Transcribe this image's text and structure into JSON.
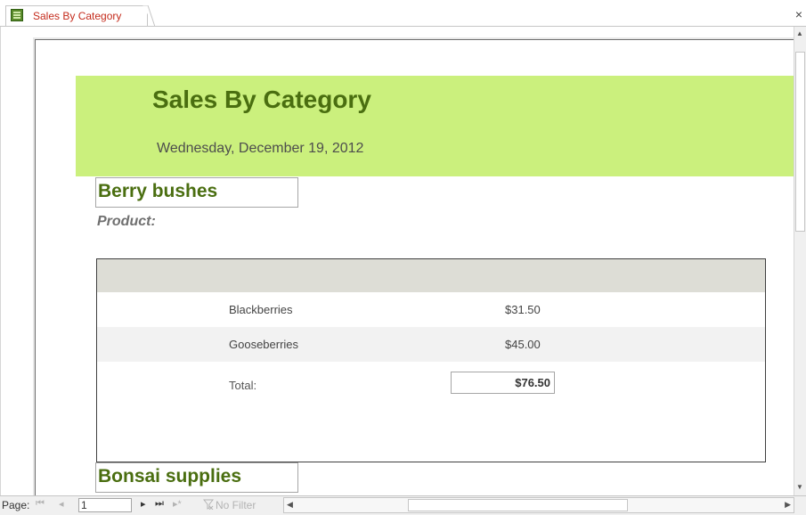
{
  "window": {
    "tab_title": "Sales By Category",
    "close_glyph": "×"
  },
  "report": {
    "title": "Sales By Category",
    "date": "Wednesday, December 19, 2012",
    "header_color": "#cbf07d",
    "title_color": "#4a6e10",
    "product_label": "Product:",
    "categories": [
      {
        "name": "Berry bushes",
        "items": [
          {
            "product": "Blackberries",
            "amount": "$31.50"
          },
          {
            "product": "Gooseberries",
            "amount": "$45.00"
          }
        ],
        "total_label": "Total:",
        "total_value": "$76.50"
      },
      {
        "name": "Bonsai supplies"
      }
    ]
  },
  "navbar": {
    "page_label": "Page:",
    "page_value": "1",
    "filter_label": "No Filter",
    "first_glyph": "⏮",
    "prev_glyph": "◂",
    "next_glyph": "▸",
    "last_glyph": "⏭",
    "new_glyph": "▸*"
  },
  "scrollbar": {
    "up_glyph": "▲",
    "down_glyph": "▼",
    "left_glyph": "◀",
    "right_glyph": "▶"
  },
  "icons": {
    "tab_icon": "report-icon",
    "filter_icon": "filter-icon"
  }
}
